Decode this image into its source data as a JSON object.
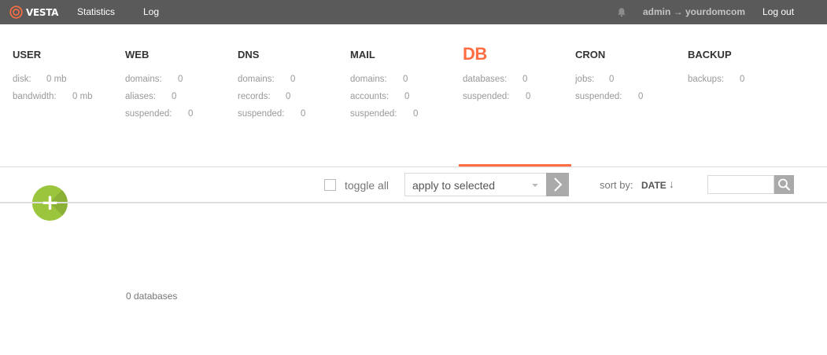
{
  "topbar": {
    "logo_text": "VESTA",
    "nav": [
      "Statistics",
      "Log"
    ],
    "user_link": "admin → yourdomcom",
    "logout": "Log out",
    "icons": {
      "logo": "vesta-logo-icon",
      "notifications": "bell-icon"
    }
  },
  "tabs": [
    {
      "title": "USER",
      "stats": [
        {
          "label": "disk:",
          "value": "0 mb"
        },
        {
          "label": "bandwidth:",
          "value": "0 mb"
        }
      ]
    },
    {
      "title": "WEB",
      "stats": [
        {
          "label": "domains:",
          "value": "0"
        },
        {
          "label": "aliases:",
          "value": "0"
        },
        {
          "label": "suspended:",
          "value": "0"
        }
      ]
    },
    {
      "title": "DNS",
      "stats": [
        {
          "label": "domains:",
          "value": "0"
        },
        {
          "label": "records:",
          "value": "0"
        },
        {
          "label": "suspended:",
          "value": "0"
        }
      ]
    },
    {
      "title": "MAIL",
      "stats": [
        {
          "label": "domains:",
          "value": "0"
        },
        {
          "label": "accounts:",
          "value": "0"
        },
        {
          "label": "suspended:",
          "value": "0"
        }
      ]
    },
    {
      "title": "DB",
      "active": true,
      "stats": [
        {
          "label": "databases:",
          "value": "0"
        },
        {
          "label": "suspended:",
          "value": "0"
        }
      ]
    },
    {
      "title": "CRON",
      "stats": [
        {
          "label": "jobs:",
          "value": "0"
        },
        {
          "label": "suspended:",
          "value": "0"
        }
      ]
    },
    {
      "title": "BACKUP",
      "stats": [
        {
          "label": "backups:",
          "value": "0"
        }
      ]
    }
  ],
  "toolbar": {
    "add_label": "+",
    "toggle_all": "toggle all",
    "bulk_action": "apply to selected",
    "sort_label": "sort by:",
    "sort_value": "DATE",
    "sort_direction": "↓",
    "search_value": ""
  },
  "content": {
    "count_text": "0 databases"
  },
  "colors": {
    "topbar_bg": "#5a5a5a",
    "accent": "#ff6e42",
    "add_button": "#9bc53d",
    "muted_text": "#999999"
  }
}
